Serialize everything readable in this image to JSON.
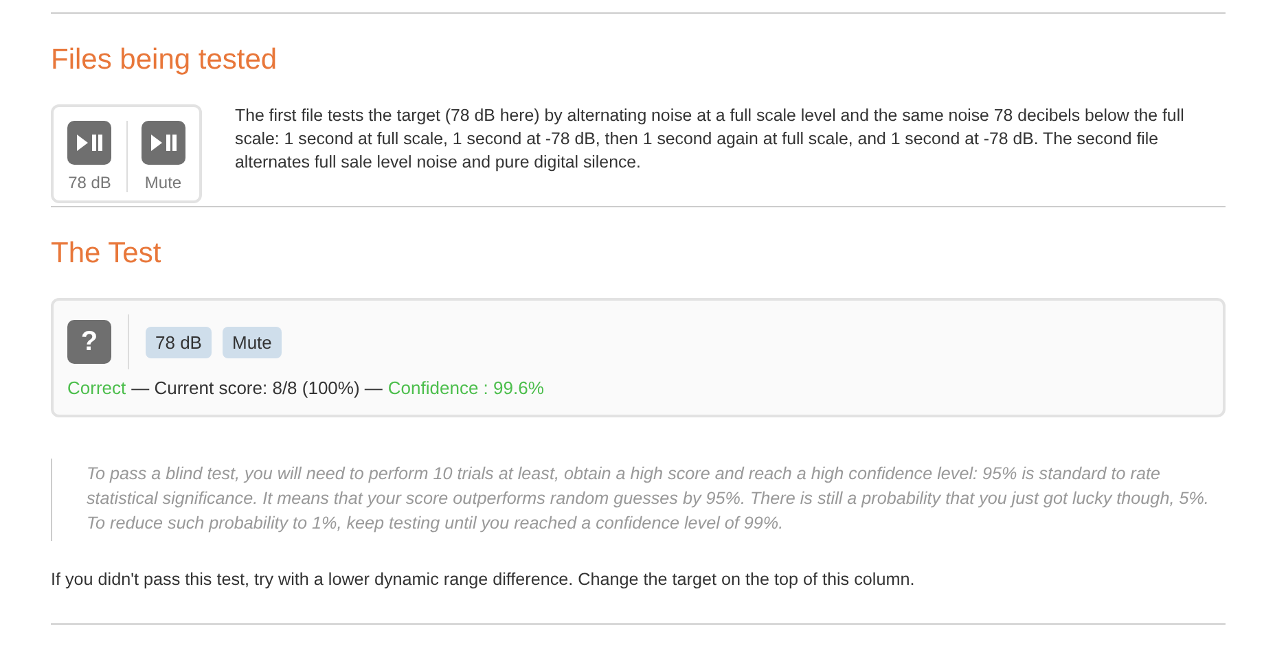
{
  "files_section": {
    "heading": "Files being tested",
    "players": [
      {
        "label": "78 dB"
      },
      {
        "label": "Mute"
      }
    ],
    "description": "The first file tests the target (78 dB here) by alternating noise at a full scale level and the same noise 78 decibels below the full scale: 1 second at full scale, 1 second at -78 dB, then 1 second again at full scale, and 1 second at -78 dB. The second file alternates full sale level noise and pure digital silence."
  },
  "test_section": {
    "heading": "The Test",
    "mystery_button": "?",
    "answers": [
      "78 dB",
      "Mute"
    ],
    "status": {
      "result": "Correct",
      "score": "— Current score: 8/8 (100%) —",
      "confidence": "Confidence : 99.6%"
    }
  },
  "note": "To pass a blind test, you will need to perform 10 trials at least, obtain a high score and reach a high confidence level: 95% is standard to rate statistical significance. It means that your score outperforms random guesses by 95%. There is still a probability that you just got lucky though, 5%. To reduce such probability to 1%, keep testing until you reached a confidence level of 99%.",
  "footer_text": "If you didn't pass this test, try with a lower dynamic range difference. Change the target on the top of this column."
}
